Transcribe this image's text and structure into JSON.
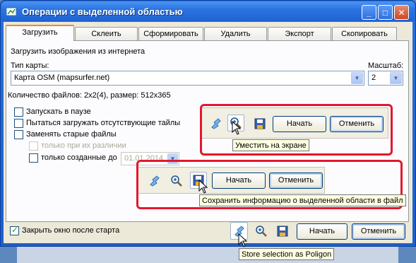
{
  "window": {
    "title": "Операции с выделенной областью"
  },
  "title_buttons": {
    "minimize": "_",
    "maximize": "□",
    "close": "✕"
  },
  "tabs": [
    {
      "label": "Загрузить"
    },
    {
      "label": "Склеить"
    },
    {
      "label": "Сформировать"
    },
    {
      "label": "Удалить"
    },
    {
      "label": "Экспорт"
    },
    {
      "label": "Скопировать"
    }
  ],
  "page": {
    "heading": "Загрузить изображения из интернета",
    "map_type_label": "Тип карты:",
    "map_type_value": "Карта OSM (mapsurfer.net)",
    "scale_label": "Масштаб:",
    "scale_value": "2",
    "files_info": "Количество файлов: 2x2(4), размер: 512x365",
    "options": {
      "pause": "Запускать в паузе",
      "try_missing": "Пытаться загружать отсутствующие тайлы",
      "replace_old": "Заменять старые файлы",
      "only_diff": "только при их различии",
      "only_created_before": "только созданные до",
      "date": "01.01.2014"
    },
    "close_after_start": "Закрыть окно после старта"
  },
  "buttons": {
    "start": "Начать",
    "cancel": "Отменить"
  },
  "tooltips": {
    "fit_screen": "Уместить на экране",
    "save_info": "Сохранить информацию о выделенной области в файл",
    "store_polygon": "Store selection as Poligon"
  },
  "colors": {
    "highlight_border": "#e3172d",
    "title_bar": "#2b74df",
    "tab_accent": "#e68b2c"
  }
}
